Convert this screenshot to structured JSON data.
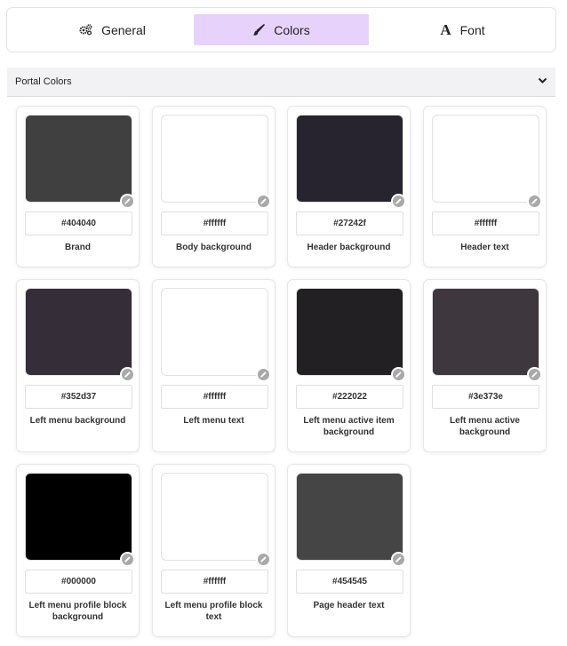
{
  "tabs": [
    {
      "label": "General",
      "icon": "gears-icon",
      "active": false
    },
    {
      "label": "Colors",
      "icon": "paintbrush-icon",
      "active": true
    },
    {
      "label": "Font",
      "icon": "font-icon",
      "active": false
    }
  ],
  "section": {
    "title": "Portal Colors",
    "collapsed": false
  },
  "colors": [
    {
      "hex": "#404040",
      "label": "Brand"
    },
    {
      "hex": "#ffffff",
      "label": "Body background"
    },
    {
      "hex": "#27242f",
      "label": "Header background"
    },
    {
      "hex": "#ffffff",
      "label": "Header text"
    },
    {
      "hex": "#352d37",
      "label": "Left menu background"
    },
    {
      "hex": "#ffffff",
      "label": "Left menu text"
    },
    {
      "hex": "#222022",
      "label": "Left menu active item background"
    },
    {
      "hex": "#3e373e",
      "label": "Left menu active background"
    },
    {
      "hex": "#000000",
      "label": "Left menu profile block background"
    },
    {
      "hex": "#ffffff",
      "label": "Left menu profile block text"
    },
    {
      "hex": "#454545",
      "label": "Page header text"
    }
  ]
}
